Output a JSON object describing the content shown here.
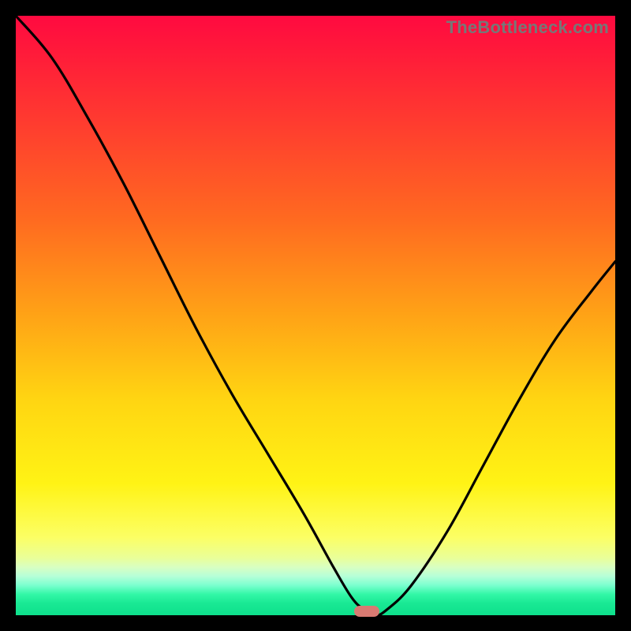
{
  "watermark": "TheBottleneck.com",
  "colors": {
    "frame": "#000000",
    "marker": "#d87a72",
    "curve": "#000000"
  },
  "chart_data": {
    "type": "line",
    "title": "",
    "xlabel": "",
    "ylabel": "",
    "xlim": [
      0,
      100
    ],
    "ylim": [
      0,
      100
    ],
    "grid": false,
    "legend": false,
    "series": [
      {
        "name": "bottleneck-curve",
        "x": [
          0,
          6,
          12,
          18,
          24,
          30,
          36,
          42,
          48,
          53,
          56,
          58,
          60,
          62,
          66,
          72,
          78,
          84,
          90,
          96,
          100
        ],
        "y": [
          100,
          93,
          83,
          72,
          60,
          48,
          37,
          27,
          17,
          8,
          3,
          1,
          0,
          1,
          5,
          14,
          25,
          36,
          46,
          54,
          59
        ]
      }
    ],
    "marker": {
      "x": 58.5,
      "y": 0.7
    },
    "background_gradient": {
      "top": "#ff0a40",
      "mid": "#ffd512",
      "bottom": "#0ee08c"
    }
  }
}
